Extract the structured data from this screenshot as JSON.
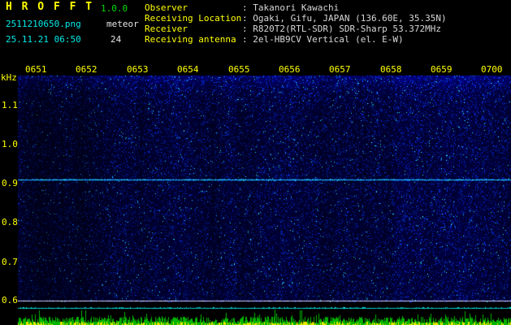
{
  "app": {
    "title": "H R O F F T",
    "version": "1.0.0",
    "filename": "2511210650.png",
    "mode": "meteor",
    "datetime": "25.11.21 06:50",
    "count": "24"
  },
  "info": {
    "rows": [
      {
        "label": "Observer",
        "value": ": Takanori Kawachi"
      },
      {
        "label": "Receiving Location",
        "value": ": Ogaki, Gifu, JAPAN (136.60E, 35.35N)"
      },
      {
        "label": "Receiver",
        "value": ": R820T2(RTL-SDR) SDR-Sharp 53.372MHz"
      },
      {
        "label": "Receiving antenna",
        "value": ": 2el-HB9CV Vertical (el. E-W)"
      }
    ]
  },
  "spectrogram": {
    "unit": "kHz",
    "time_labels": [
      "0651",
      "0652",
      "0653",
      "0654",
      "0655",
      "0656",
      "0657",
      "0658",
      "0659",
      "0700"
    ],
    "freq_labels": [
      "1.1",
      "1.0",
      "0.9",
      "0.8",
      "0.7",
      "0.6"
    ],
    "freq_ticks_khz": [
      1.1,
      1.0,
      0.9,
      0.8,
      0.7,
      0.6
    ],
    "carrier_line_khz": 0.91,
    "baseline_khz": 0.6,
    "features": [
      "continuous cyan carrier line near 0.91 kHz",
      "white horizontal line at 0.6 kHz",
      "dark blue random noise background, brighter band at top",
      "bottom strip: cyan reference line above green/yellow signal-level spikes"
    ],
    "colors": {
      "axis_text": "#ffff00",
      "noise_base": "#000030",
      "carrier_line": "#00ffff",
      "baseline_white": "#d0d0e8",
      "bottom_reference": "#00d2d2",
      "signal_green": "#00b400",
      "signal_yellow": "#e8e800",
      "background": "#000000"
    }
  }
}
